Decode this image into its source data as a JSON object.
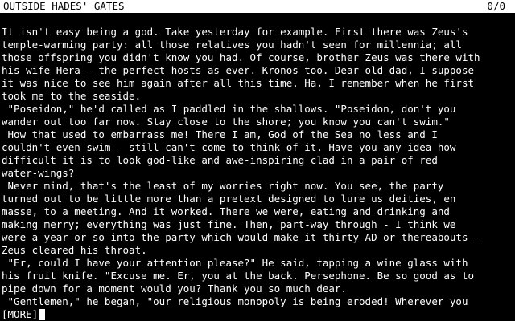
{
  "status_bar": {
    "location": "OUTSIDE HADES' GATES",
    "score": "0/0"
  },
  "story_lines": [
    "It isn't easy being a god. Take yesterday for example. First there was Zeus's",
    "temple-warming party: all those relatives you hadn't seen for millennia; all",
    "those offspring you didn't know you had. Of course, brother Zeus was there with",
    "his wife Hera - the perfect hosts as ever. Kronos too. Dear old dad, I suppose",
    "it was nice to see him again after all this time. Ha, I remember when he first",
    "took me to the seaside.",
    " \"Poseidon,\" he'd called as I paddled in the shallows. \"Poseidon, don't you",
    "wander out too far now. Stay close to the shore; you know you can't swim.\"",
    " How that used to embarrass me! There I am, God of the Sea no less and I",
    "couldn't even swim - still can't come to think of it. Have you any idea how",
    "difficult it is to look god-like and awe-inspiring clad in a pair of red",
    "water-wings?",
    " Never mind, that's the least of my worries right now. You see, the party",
    "turned out to be little more than a pretext designed to lure us deities, en",
    "masse, to a meeting. And it worked. There we were, eating and drinking and",
    "making merry; everything was just fine. Then, part-way through - I think we",
    "were a year or so into the party which would make it thirty AD or thereabouts -",
    "Zeus cleared his throat.",
    " \"Er, could I have your attention please?\" He said, tapping a wine glass with",
    "his fruit knife. \"Excuse me. Er, you at the back. Persephone. Be so good as to",
    "pipe down for a moment would you? Thank you so much dear.",
    " \"Gentlemen,\" he began, \"our religious monopoly is being eroded! Wherever you"
  ],
  "prompt": {
    "more_label": "[MORE]"
  }
}
